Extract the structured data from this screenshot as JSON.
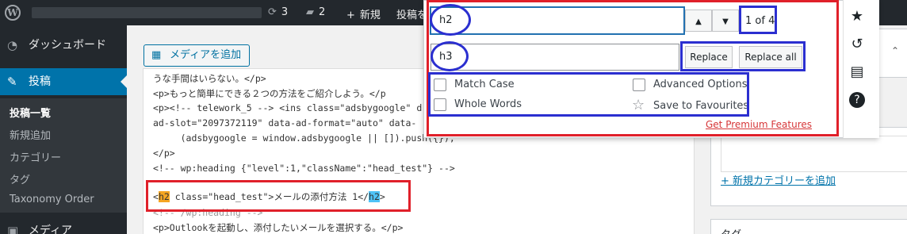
{
  "adminbar": {
    "wp_logo": "W",
    "updates_count": "3",
    "comments_count": "2",
    "new_label": "新規",
    "post_label": "投稿を",
    "icons": {
      "updates": "refresh-icon",
      "comments": "comment-icon",
      "new": "plus-icon"
    }
  },
  "sidebar": {
    "dashboard": "ダッシュボード",
    "posts": "投稿",
    "sub": [
      "投稿一覧",
      "新規追加",
      "カテゴリー",
      "タグ",
      "Taxonomy Order"
    ],
    "media": "メディア",
    "accent": "#0073aa"
  },
  "toolbar": {
    "add_media": "メディアを追加"
  },
  "editor": {
    "line1": "うな手間はいらない。</p>",
    "line2": "<p>もっと簡単にできる２つの方法をご紹介しよう。</p",
    "line3": "<p><!-- telework_5 --> <ins class=\"adsbygoogle\" d",
    "line4": "ad-slot=\"2097372119\" data-ad-format=\"auto\" data-",
    "line5": "     (adsbygoogle = window.adsbygoogle || []).push({});",
    "line6": "</p>",
    "line7": "<!-- wp:heading {\"level\":1,\"className\":\"head_test\"} -->",
    "line8_open": "<",
    "line8_tag1": "h2",
    "line8_mid": " class=\"head_test\">メールの添付方法 1</",
    "line8_tag2": "h2",
    "line8_close": ">",
    "line9": "<!-- /wp:heading -->",
    "line10": "<p>Outlookを起動し、添付したいメールを選択する。</p>"
  },
  "meta": {
    "add_category": "+ 新規カテゴリーを追加",
    "tags_title": "タグ"
  },
  "find_replace": {
    "find_value": "h2",
    "replace_value": "h3",
    "count": "1 of 4",
    "replace": "Replace",
    "replace_all": "Replace all",
    "match_case": "Match Case",
    "whole_words": "Whole Words",
    "advanced_options": "Advanced Options",
    "save_favourites": "Save to Favourites",
    "premium": "Get Premium Features",
    "up_arrow": "▲",
    "down_arrow": "▼"
  },
  "side_tools": {
    "star": "★",
    "history": "↺",
    "book": "▤",
    "help": "?"
  },
  "colors": {
    "annotation_red": "#e0202a",
    "annotation_blue": "#2b2fd0"
  }
}
